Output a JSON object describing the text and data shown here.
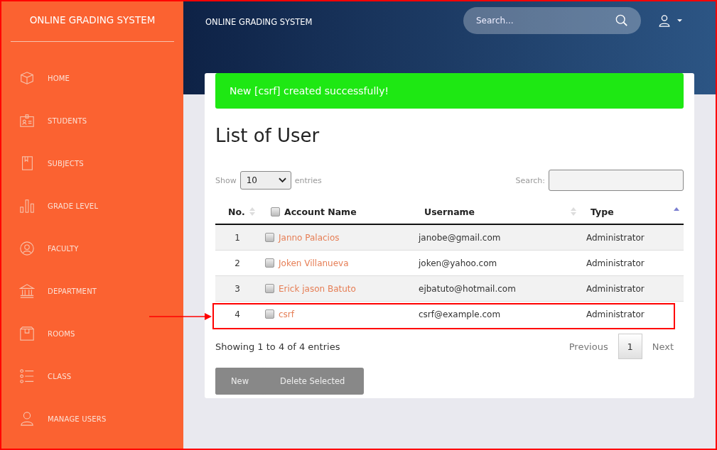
{
  "sidebar": {
    "title": "ONLINE GRADING SYSTEM",
    "items": [
      {
        "label": "HOME"
      },
      {
        "label": "STUDENTS"
      },
      {
        "label": "SUBJECTS"
      },
      {
        "label": "GRADE LEVEL"
      },
      {
        "label": "FACULTY"
      },
      {
        "label": "DEPARTMENT"
      },
      {
        "label": "ROOMS"
      },
      {
        "label": "CLASS"
      },
      {
        "label": "MANAGE USERS"
      }
    ]
  },
  "header": {
    "title": "ONLINE GRADING SYSTEM",
    "search": {
      "placeholder": "Search..."
    }
  },
  "alert": {
    "text": "New [csrf] created successfully!"
  },
  "page_title": "List of User",
  "length_menu": {
    "label_before": "Show",
    "value": "10",
    "label_after": "entries"
  },
  "table_search": {
    "label": "Search:"
  },
  "table": {
    "columns": [
      {
        "label": "No.",
        "kind": "sortable",
        "sorted": false
      },
      {
        "label": "Account Name",
        "kind": "checkbox",
        "checked": false
      },
      {
        "label": "Username",
        "kind": "sortable",
        "sorted": false
      },
      {
        "label": "Type",
        "kind": "sortable",
        "sorted": true
      }
    ],
    "rows": [
      {
        "no": "1",
        "name": "Janno Palacios",
        "username": "janobe@gmail.com",
        "type": "Administrator",
        "checked": false,
        "highlighted": false
      },
      {
        "no": "2",
        "name": "Joken Villanueva",
        "username": "joken@yahoo.com",
        "type": "Administrator",
        "checked": false,
        "highlighted": false
      },
      {
        "no": "3",
        "name": "Erick jason Batuto",
        "username": "ejbatuto@hotmail.com",
        "type": "Administrator",
        "checked": false,
        "highlighted": false
      },
      {
        "no": "4",
        "name": "csrf",
        "username": "csrf@example.com",
        "type": "Administrator",
        "checked": false,
        "highlighted": true
      }
    ]
  },
  "info": "Showing 1 to 4 of 4 entries",
  "pagination": {
    "previous": "Previous",
    "pages": [
      {
        "label": "1",
        "selected": true
      }
    ],
    "next": "Next"
  },
  "buttons": [
    "New",
    "Delete Selected"
  ]
}
